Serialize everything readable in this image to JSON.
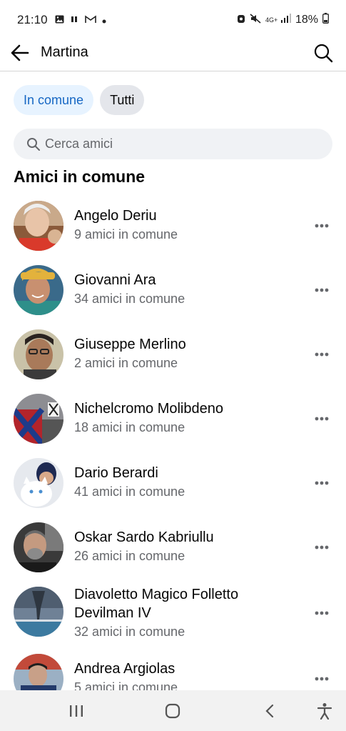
{
  "status_bar": {
    "time": "21:10",
    "network": "4G+",
    "battery": "18%"
  },
  "header": {
    "title": "Martina"
  },
  "tabs": [
    {
      "label": "In comune",
      "active": true
    },
    {
      "label": "Tutti",
      "active": false
    }
  ],
  "search": {
    "placeholder": "Cerca amici"
  },
  "section": {
    "title": "Amici in comune"
  },
  "friends": [
    {
      "name": "Angelo Deriu",
      "mutual": "9 amici in comune"
    },
    {
      "name": "Giovanni Ara",
      "mutual": "34 amici in comune"
    },
    {
      "name": "Giuseppe Merlino",
      "mutual": "2 amici in comune"
    },
    {
      "name": "Nichelcromo Molibdeno",
      "mutual": "18 amici in comune"
    },
    {
      "name": "Dario Berardi",
      "mutual": "41 amici in comune"
    },
    {
      "name": "Oskar Sardo Kabriullu",
      "mutual": "26 amici in comune"
    },
    {
      "name": "Diavoletto Magico Folletto Devilman IV",
      "name_line1": "Diavoletto Magico Folletto",
      "name_line2": "Devilman IV",
      "mutual": "32 amici in comune"
    },
    {
      "name": "Andrea Argiolas",
      "mutual": "5 amici in comune"
    }
  ],
  "colors": {
    "accent": "#1667c4",
    "chip_active_bg": "#e7f3ff",
    "chip_inactive_bg": "#e4e6eb",
    "secondary_text": "#65676b",
    "search_bg": "#f0f2f5",
    "nav_bg": "#f2f2f2"
  }
}
